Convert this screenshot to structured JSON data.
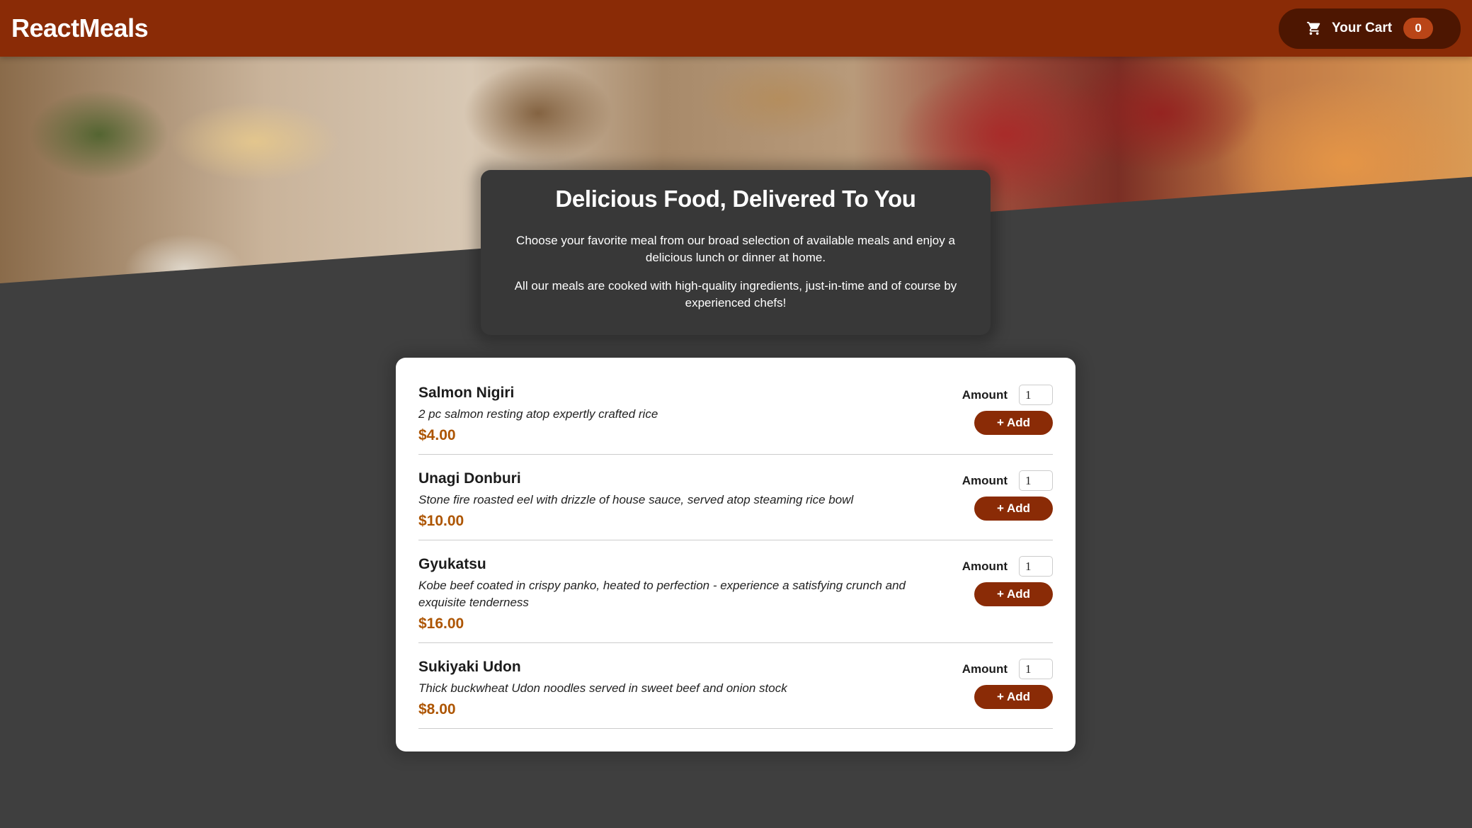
{
  "header": {
    "brand": "ReactMeals",
    "cart_label": "Your Cart",
    "cart_count": "0",
    "cart_icon": "cart-icon"
  },
  "hero": {
    "image_alt": "A table full of delicious food!"
  },
  "summary": {
    "title": "Delicious Food, Delivered To You",
    "paragraph_1": "Choose your favorite meal from our broad selection of available meals and enjoy a delicious lunch or dinner at home.",
    "paragraph_2": "All our meals are cooked with high-quality ingredients, just-in-time and of course by experienced chefs!"
  },
  "meals": [
    {
      "name": "Salmon Nigiri",
      "description": "2 pc salmon resting atop expertly crafted rice",
      "price": "$4.00",
      "amount_label": "Amount",
      "amount_value": "1",
      "add_label": "+ Add"
    },
    {
      "name": "Unagi Donburi",
      "description": "Stone fire roasted eel with drizzle of house sauce, served atop steaming rice bowl",
      "price": "$10.00",
      "amount_label": "Amount",
      "amount_value": "1",
      "add_label": "+ Add"
    },
    {
      "name": "Gyukatsu",
      "description": "Kobe beef coated in crispy panko, heated to perfection - experience a satisfying crunch and exquisite tenderness",
      "price": "$16.00",
      "amount_label": "Amount",
      "amount_value": "1",
      "add_label": "+ Add"
    },
    {
      "name": "Sukiyaki Udon",
      "description": "Thick buckwheat Udon noodles served in sweet beef and onion stock",
      "price": "$8.00",
      "amount_label": "Amount",
      "amount_value": "1",
      "add_label": "+ Add"
    }
  ],
  "colors": {
    "header": "#8a2b06",
    "cart_button": "#4d1601",
    "cart_badge": "#b94517",
    "page_background": "#3f3f3f",
    "summary_background": "#383838",
    "price": "#ad5502",
    "add_button": "#8a2b06"
  }
}
